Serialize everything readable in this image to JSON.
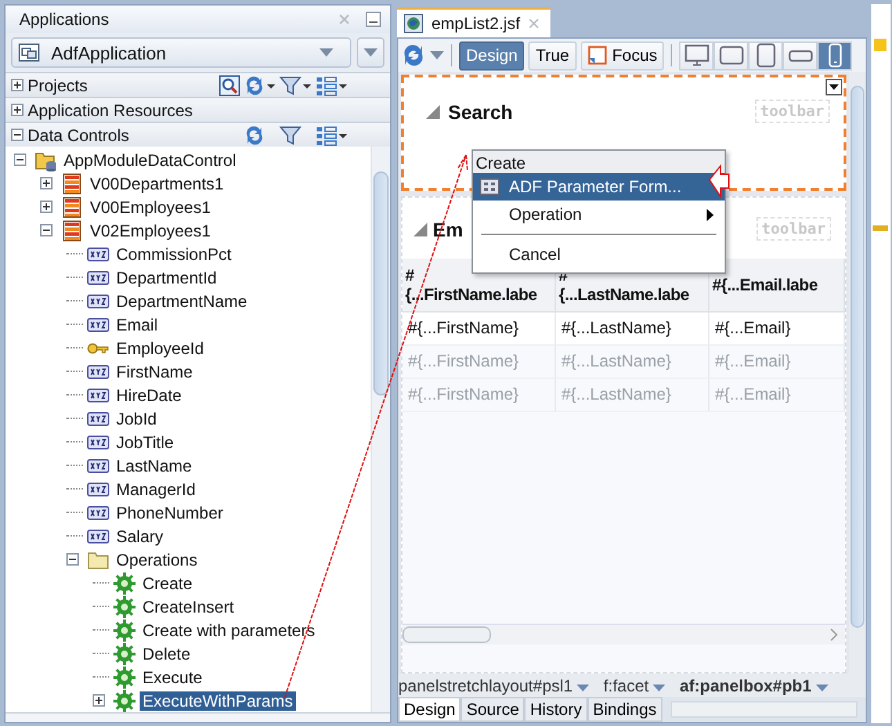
{
  "left_panel": {
    "title": "Applications",
    "application_selector": {
      "value": "AdfApplication"
    },
    "sections": [
      {
        "label": "Projects",
        "expanded": false,
        "kind": "projects"
      },
      {
        "label": "Application Resources",
        "expanded": false,
        "kind": "resources"
      },
      {
        "label": "Data Controls",
        "expanded": true,
        "kind": "datacontrols"
      }
    ],
    "tree": [
      {
        "label": "AppModuleDataControl",
        "kind": "module",
        "expanded": true,
        "selected": false,
        "children": [
          {
            "label": "V00Departments1",
            "kind": "collection",
            "expanded": false,
            "selected": false
          },
          {
            "label": "V00Employees1",
            "kind": "collection",
            "expanded": false,
            "selected": false
          },
          {
            "label": "V02Employees1",
            "kind": "collection",
            "expanded": true,
            "selected": false,
            "children": [
              {
                "label": "CommissionPct",
                "kind": "attribute",
                "selected": false
              },
              {
                "label": "DepartmentId",
                "kind": "attribute",
                "selected": false
              },
              {
                "label": "DepartmentName",
                "kind": "attribute",
                "selected": false
              },
              {
                "label": "Email",
                "kind": "attribute",
                "selected": false
              },
              {
                "label": "EmployeeId",
                "kind": "key",
                "selected": false
              },
              {
                "label": "FirstName",
                "kind": "attribute",
                "selected": false
              },
              {
                "label": "HireDate",
                "kind": "attribute",
                "selected": false
              },
              {
                "label": "JobId",
                "kind": "attribute",
                "selected": false
              },
              {
                "label": "JobTitle",
                "kind": "attribute",
                "selected": false
              },
              {
                "label": "LastName",
                "kind": "attribute",
                "selected": false
              },
              {
                "label": "ManagerId",
                "kind": "attribute",
                "selected": false
              },
              {
                "label": "PhoneNumber",
                "kind": "attribute",
                "selected": false
              },
              {
                "label": "Salary",
                "kind": "attribute",
                "selected": false
              },
              {
                "label": "Operations",
                "kind": "folder",
                "expanded": true,
                "selected": false,
                "children": [
                  {
                    "label": "Create",
                    "kind": "operation",
                    "selected": false
                  },
                  {
                    "label": "CreateInsert",
                    "kind": "operation",
                    "selected": false
                  },
                  {
                    "label": "Create with parameters",
                    "kind": "operation",
                    "selected": false
                  },
                  {
                    "label": "Delete",
                    "kind": "operation",
                    "selected": false
                  },
                  {
                    "label": "Execute",
                    "kind": "operation",
                    "selected": false
                  },
                  {
                    "label": "ExecuteWithParams",
                    "kind": "operation",
                    "expanded": false,
                    "selected": true
                  }
                ]
              }
            ]
          }
        ]
      }
    ]
  },
  "editor": {
    "tab": {
      "label": "empList2.jsf"
    },
    "modes": [
      {
        "label": "Design",
        "selected": true
      },
      {
        "label": "True",
        "selected": false
      }
    ],
    "focus_button": "Focus",
    "devices": [
      {
        "kind": "desktop",
        "selected": false
      },
      {
        "kind": "tablet-landscape",
        "selected": false
      },
      {
        "kind": "tablet",
        "selected": false
      },
      {
        "kind": "phone-landscape",
        "selected": false
      },
      {
        "kind": "phone",
        "selected": true
      }
    ],
    "search_panel": {
      "title": "Search",
      "toolbar_label": "toolbar"
    },
    "employees_panel": {
      "title": "Em",
      "toolbar_label": "toolbar",
      "columns": [
        {
          "lines": [
            "#",
            "{...FirstName.labe"
          ]
        },
        {
          "lines": [
            "#",
            "{...LastName.labe"
          ]
        },
        {
          "lines": [
            "#{...Email.labe"
          ]
        }
      ],
      "rows": [
        {
          "dimmed": false,
          "cells": [
            "#{...FirstName}",
            "#{...LastName}",
            "#{...Email}"
          ]
        },
        {
          "dimmed": true,
          "cells": [
            "#{...FirstName}",
            "#{...LastName}",
            "#{...Email}"
          ]
        },
        {
          "dimmed": true,
          "cells": [
            "#{...FirstName}",
            "#{...LastName}",
            "#{...Email}"
          ]
        }
      ]
    },
    "breadcrumb": [
      {
        "label": "panelstretchlayout#psl1",
        "current": false
      },
      {
        "label": "f:facet",
        "current": false
      },
      {
        "label": "af:panelbox#pb1",
        "current": true
      }
    ],
    "bottom_tabs": [
      {
        "label": "Design",
        "selected": true
      },
      {
        "label": "Source",
        "selected": false
      },
      {
        "label": "History",
        "selected": false
      },
      {
        "label": "Bindings",
        "selected": false
      }
    ]
  },
  "context_menu": {
    "header": "Create",
    "items": [
      {
        "kind": "command",
        "label": "ADF Parameter Form...",
        "selected": true
      },
      {
        "kind": "submenu",
        "label": "Operation",
        "selected": false
      },
      {
        "kind": "separator"
      },
      {
        "kind": "command",
        "label": "Cancel",
        "selected": false
      }
    ]
  }
}
